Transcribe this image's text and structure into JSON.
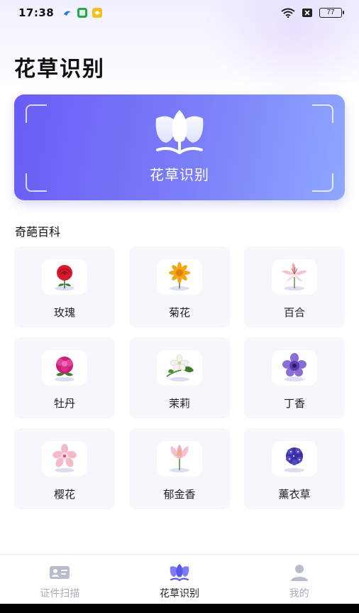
{
  "status_bar": {
    "time": "17:38",
    "battery": "77"
  },
  "page_title": "花草识别",
  "banner": {
    "label": "花草识别",
    "icon": "lotus-icon"
  },
  "section_title": "奇葩百科",
  "flowers": [
    {
      "name": "玫瑰",
      "icon": "rose-icon",
      "color": "#d8192b"
    },
    {
      "name": "菊花",
      "icon": "chrysanthemum-icon",
      "color": "#f4a512"
    },
    {
      "name": "百合",
      "icon": "lily-icon",
      "color": "#f4b8c8"
    },
    {
      "name": "牡丹",
      "icon": "peony-icon",
      "color": "#c8207a"
    },
    {
      "name": "茉莉",
      "icon": "jasmine-icon",
      "color": "#f3f3ec"
    },
    {
      "name": "丁香",
      "icon": "lilac-icon",
      "color": "#7b5bc7"
    },
    {
      "name": "樱花",
      "icon": "cherry-blossom-icon",
      "color": "#f6b9c8"
    },
    {
      "name": "郁金香",
      "icon": "tulip-icon",
      "color": "#f3a7bf"
    },
    {
      "name": "薰衣草",
      "icon": "lavender-icon",
      "color": "#3b2fa8"
    }
  ],
  "nav": [
    {
      "label": "证件扫描",
      "icon": "id-card-icon",
      "active": false
    },
    {
      "label": "花草识别",
      "icon": "lotus-icon",
      "active": true
    },
    {
      "label": "我的",
      "icon": "user-icon",
      "active": false
    }
  ],
  "colors": {
    "accent": "#6a5cf6",
    "card_bg": "#f6f7fc",
    "nav_inactive": "#a8adbd"
  }
}
